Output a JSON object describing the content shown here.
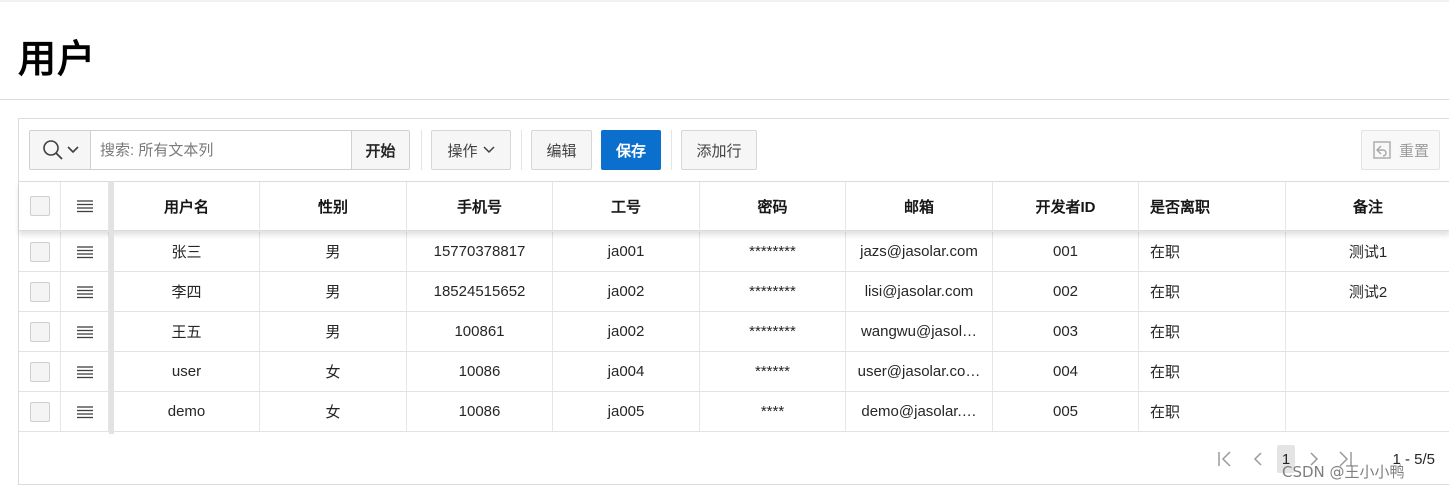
{
  "page": {
    "title": "用户"
  },
  "toolbar": {
    "search_placeholder": "搜索: 所有文本列",
    "go_label": "开始",
    "actions_label": "操作",
    "edit_label": "编辑",
    "save_label": "保存",
    "add_row_label": "添加行",
    "reset_label": "重置"
  },
  "grid": {
    "columns": [
      "用户名",
      "性别",
      "手机号",
      "工号",
      "密码",
      "邮箱",
      "开发者ID",
      "是否离职",
      "备注"
    ],
    "rows": [
      [
        "张三",
        "男",
        "15770378817",
        "ja001",
        "********",
        "jazs@jasolar.com",
        "001",
        "在职",
        "测试1"
      ],
      [
        "李四",
        "男",
        "18524515652",
        "ja002",
        "********",
        "lisi@jasolar.com",
        "002",
        "在职",
        "测试2"
      ],
      [
        "王五",
        "男",
        "100861",
        "ja002",
        "********",
        "wangwu@jasol…",
        "003",
        "在职",
        ""
      ],
      [
        "user",
        "女",
        "10086",
        "ja004",
        "******",
        "user@jasolar.co…",
        "004",
        "在职",
        ""
      ],
      [
        "demo",
        "女",
        "10086",
        "ja005",
        "****",
        "demo@jasolar.…",
        "005",
        "在职",
        ""
      ]
    ]
  },
  "pagination": {
    "current_page": "1",
    "range": "1 - 5/5"
  },
  "watermark": "CSDN @王小小鸭",
  "colors": {
    "primary": "#0b6fce",
    "border": "#dcdcdc"
  }
}
